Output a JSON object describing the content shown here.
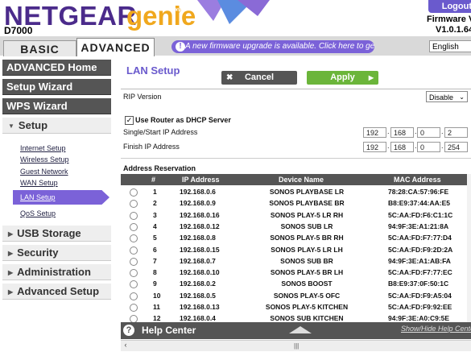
{
  "header": {
    "brand": "NETGEAR",
    "product": "genie",
    "tm": "®",
    "model": "D7000",
    "logout_label": "Logout",
    "firmware_label": "Firmware Vers",
    "firmware_version": "V1.0.1.64_1"
  },
  "tabs": {
    "basic": "BASIC",
    "advanced": "ADVANCED"
  },
  "upgrade_notice": "A new firmware upgrade is available. Click here to get it.",
  "language": "English",
  "sidebar": {
    "advanced_home": "ADVANCED Home",
    "setup_wizard": "Setup Wizard",
    "wps_wizard": "WPS Wizard",
    "setup": "Setup",
    "setup_items": [
      "Internet Setup",
      "Wireless Setup",
      "Guest Network",
      "WAN Setup",
      "LAN Setup",
      "QoS Setup"
    ],
    "usb_storage": "USB Storage",
    "security": "Security",
    "administration": "Administration",
    "advanced_setup": "Advanced Setup"
  },
  "main": {
    "title": "LAN Setup",
    "cancel": "Cancel",
    "apply": "Apply",
    "rip_version_label": "RIP Version",
    "rip_version_value": "Disable",
    "dhcp_label": "Use Router as DHCP Server",
    "dhcp_checked": "✓",
    "start_ip_label": "Single/Start IP Address",
    "start_ip": [
      "192",
      "168",
      "0",
      "2"
    ],
    "finish_ip_label": "Finish IP Address",
    "finish_ip": [
      "192",
      "168",
      "0",
      "254"
    ],
    "reservation_title": "Address Reservation",
    "columns": [
      "#",
      "IP Address",
      "Device Name",
      "MAC Address"
    ],
    "reservations": [
      {
        "n": "1",
        "ip": "192.168.0.6",
        "name": "SONOS PLAYBASE LR",
        "mac": "78:28:CA:57:96:FE"
      },
      {
        "n": "2",
        "ip": "192.168.0.9",
        "name": "SONOS PLAYBASE BR",
        "mac": "B8:E9:37:44:AA:E5"
      },
      {
        "n": "3",
        "ip": "192.168.0.16",
        "name": "SONOS PLAY-5 LR RH",
        "mac": "5C:AA:FD:F6:C1:1C"
      },
      {
        "n": "4",
        "ip": "192.168.0.12",
        "name": "SONOS SUB LR",
        "mac": "94:9F:3E:A1:21:8A"
      },
      {
        "n": "5",
        "ip": "192.168.0.8",
        "name": "SONOS PLAY-5 BR RH",
        "mac": "5C:AA:FD:F7:77:D4"
      },
      {
        "n": "6",
        "ip": "192.168.0.15",
        "name": "SONOS PLAY-5 LR LH",
        "mac": "5C:AA:FD:F9:2D:2A"
      },
      {
        "n": "7",
        "ip": "192.168.0.7",
        "name": "SONOS SUB BR",
        "mac": "94:9F:3E:A1:AB:FA"
      },
      {
        "n": "8",
        "ip": "192.168.0.10",
        "name": "SONOS PLAY-5 BR LH",
        "mac": "5C:AA:FD:F7:77:EC"
      },
      {
        "n": "9",
        "ip": "192.168.0.2",
        "name": "SONOS BOOST",
        "mac": "B8:E9:37:0F:50:1C"
      },
      {
        "n": "10",
        "ip": "192.168.0.5",
        "name": "SONOS PLAY-5 OFC",
        "mac": "5C:AA:FD:F9:A5:04"
      },
      {
        "n": "11",
        "ip": "192.168.0.13",
        "name": "SONOS PLAY-5 KITCHEN",
        "mac": "5C:AA:FD:F9:92:EE"
      },
      {
        "n": "12",
        "ip": "192.168.0.4",
        "name": "SONOS SUB KITCHEN",
        "mac": "94:9F:3E:A0:C9:5E"
      }
    ]
  },
  "help": {
    "label": "Help Center",
    "toggle": "Show/Hide Help Center"
  },
  "icons": {
    "upgrade": "info-icon",
    "help": "question-icon",
    "cancel": "close-icon",
    "apply": "arrow-right-icon"
  },
  "colors": {
    "brand_purple": "#4b2b8b",
    "genie_orange": "#f0a81e",
    "accent": "#7b62d8",
    "apply_green": "#6bb53a"
  }
}
